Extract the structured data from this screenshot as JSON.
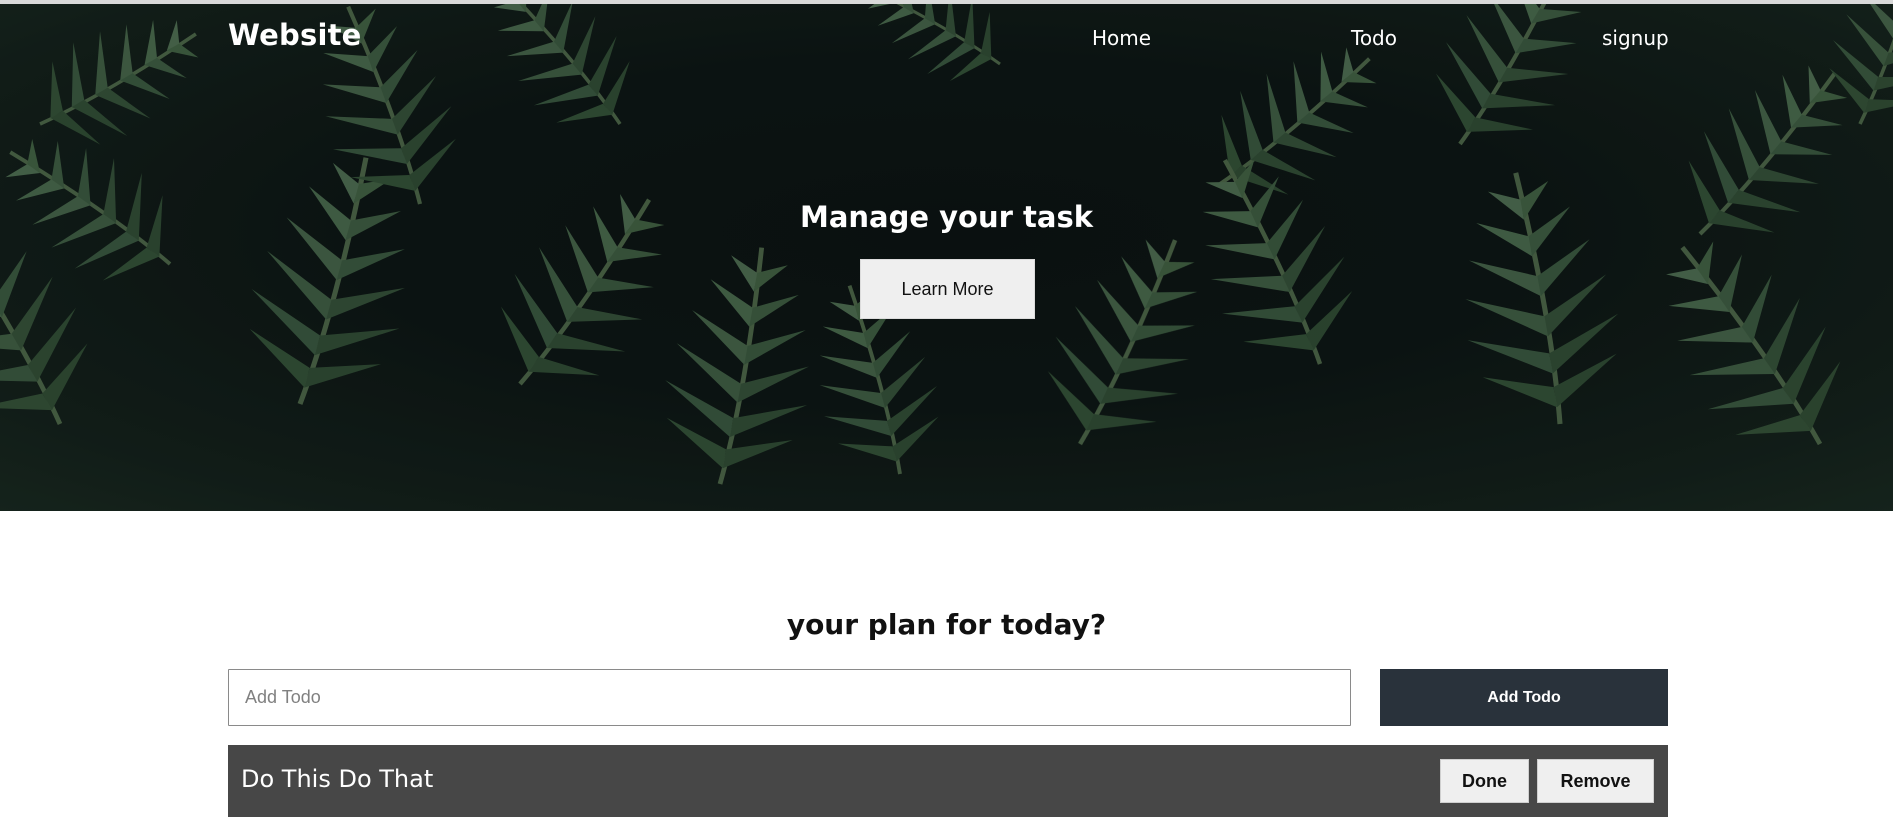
{
  "nav": {
    "logo": "Website",
    "links": [
      "Home",
      "Todo",
      "signup"
    ]
  },
  "hero": {
    "title": "Manage your task",
    "button": "Learn More"
  },
  "todo_section": {
    "title": "your plan for today?",
    "input_placeholder": "Add Todo",
    "add_button": "Add Todo",
    "items": [
      {
        "text": "Do This Do That",
        "done_label": "Done",
        "remove_label": "Remove"
      }
    ]
  },
  "colors": {
    "hero_background": "#0d1513",
    "foliage": "#3d5a3e",
    "add_button": "#29323b",
    "todo_item_background": "#474747",
    "button_light": "#efefef"
  }
}
